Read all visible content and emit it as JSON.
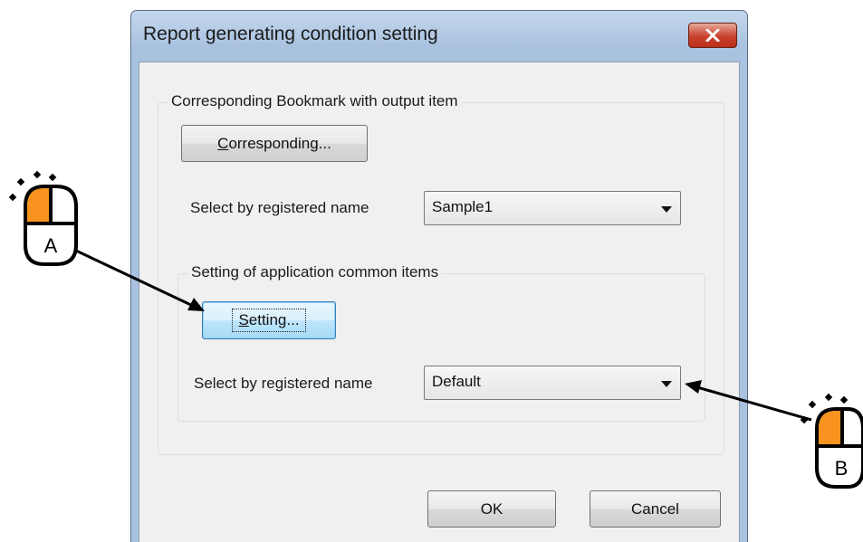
{
  "window": {
    "title": "Report generating condition setting",
    "close_icon": "close-icon",
    "accent_close": "#c8412c"
  },
  "bookmark_group": {
    "label": "Corresponding Bookmark with output item",
    "corresponding_button": {
      "underline_char": "C",
      "rest": "orresponding..."
    },
    "select_label": "Select by registered name",
    "select_value": "Sample1"
  },
  "common_group": {
    "label": "Setting of application common items",
    "setting_button": {
      "underline_char": "S",
      "rest": "etting..."
    },
    "select_label": "Select by registered name",
    "select_value": "Default"
  },
  "footer": {
    "ok_label": "OK",
    "cancel_label": "Cancel"
  },
  "annotations": {
    "mouse_a_label": "A",
    "mouse_b_label": "B",
    "mouse_icon": "mouse-icon",
    "highlight_color": "#f7931e"
  }
}
